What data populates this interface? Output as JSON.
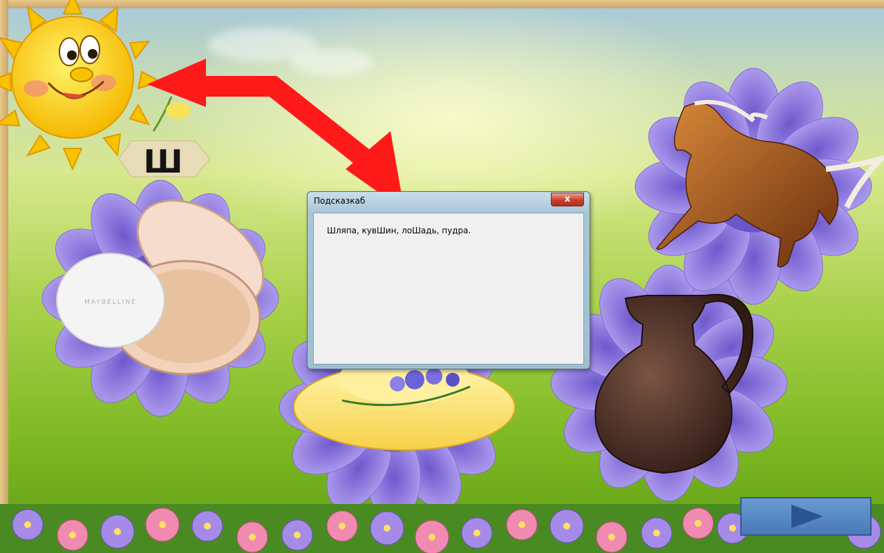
{
  "dialog": {
    "title": "Подсказкаб",
    "close_glyph": "x",
    "message": "Шляпа, кувШин, лоШадь, пудра."
  },
  "letter_tile": {
    "letter": "Ш"
  },
  "compact": {
    "brand": "MAYBELLINE"
  },
  "next_button": {
    "icon": "play-triangle-icon"
  },
  "colors": {
    "arrow": "#ff1a1a",
    "flower": "#9a85e6",
    "button": "#4f7fbf"
  }
}
